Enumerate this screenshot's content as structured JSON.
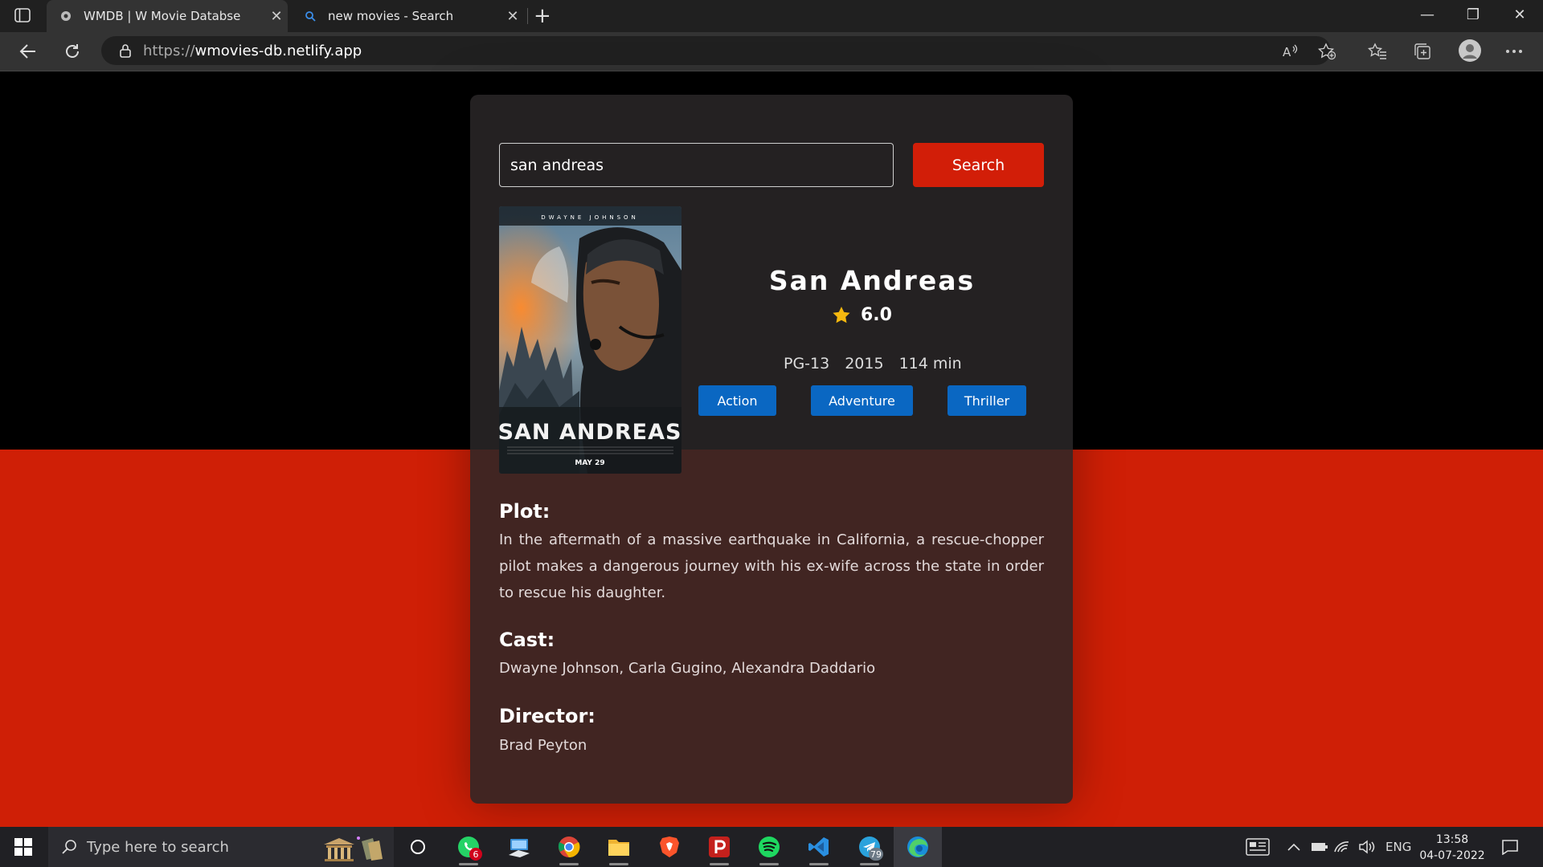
{
  "browser": {
    "tabs": [
      {
        "title": "WMDB | W Movie Databse",
        "active": true
      },
      {
        "title": "new movies - Search",
        "active": false
      }
    ],
    "url_prefix": "https://",
    "url_host": "wmovies-db.netlify.app"
  },
  "search": {
    "value": "san andreas",
    "button_label": "Search"
  },
  "movie": {
    "title": "San Andreas",
    "rating": "6.0",
    "rated": "PG-13",
    "year": "2015",
    "runtime": "114 min",
    "genres": [
      "Action",
      "Adventure",
      "Thriller"
    ],
    "poster": {
      "top_text": "DWAYNE JOHNSON",
      "title": "SAN ANDREAS",
      "date": "MAY 29"
    },
    "plot_label": "Plot:",
    "plot": "In the aftermath of a massive earthquake in California, a rescue-chopper pilot makes a dangerous journey with his ex-wife across the state in order to rescue his daughter.",
    "cast_label": "Cast:",
    "cast": "Dwayne Johnson, Carla Gugino, Alexandra Daddario",
    "director_label": "Director:",
    "director": "Brad Peyton"
  },
  "taskbar": {
    "search_placeholder": "Type here to search",
    "whatsapp_badge": "6",
    "telegram_badge": "79",
    "language": "ENG",
    "time": "13:58",
    "date": "04-07-2022"
  },
  "colors": {
    "accent_red": "#d21e08",
    "genre_blue": "#0a67c2",
    "star_gold": "#f5b80f"
  }
}
